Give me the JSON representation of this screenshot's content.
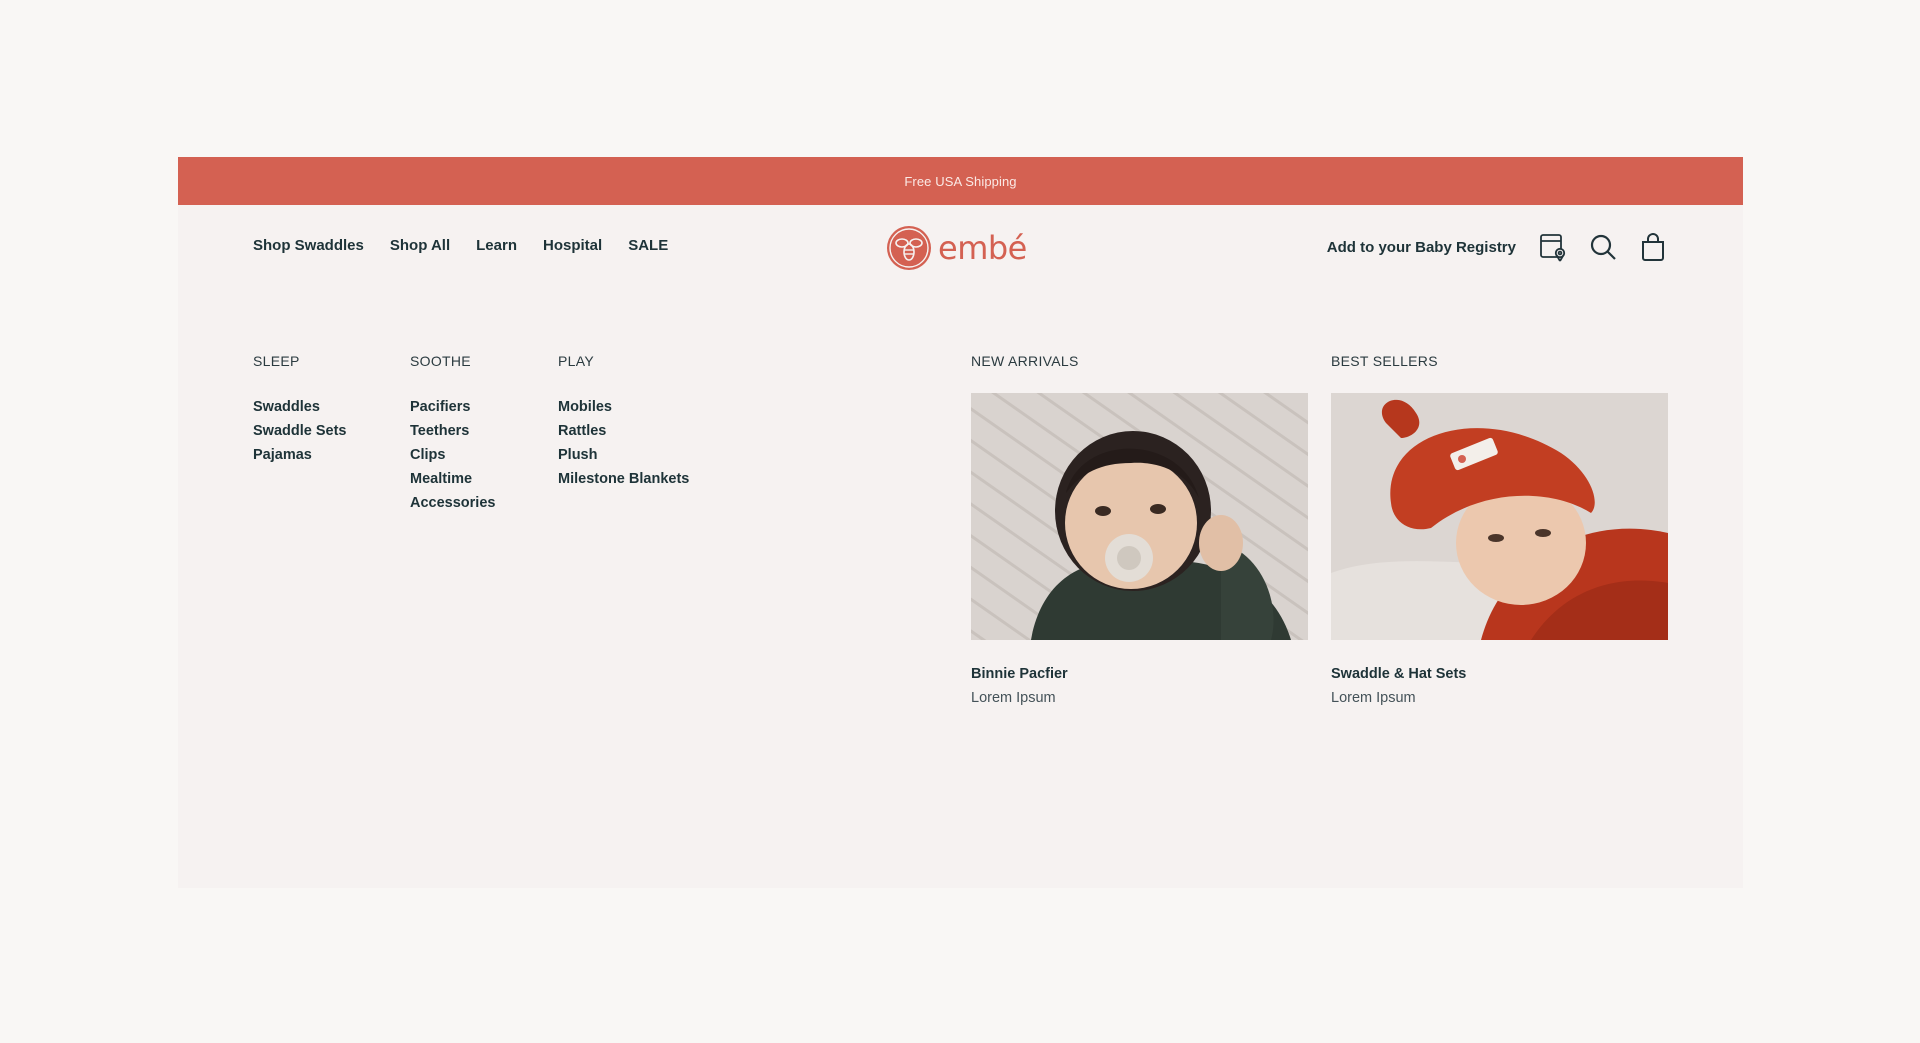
{
  "announcement": "Free USA Shipping",
  "brand": {
    "name": "embé",
    "accent": "#d46152"
  },
  "nav": {
    "left": [
      "Shop Swaddles",
      "Shop All",
      "Learn",
      "Hospital",
      "SALE"
    ],
    "registry": "Add to your Baby Registry",
    "icons": [
      "registry-gift-icon",
      "search-icon",
      "shopping-bag-icon"
    ]
  },
  "menu": {
    "columns": [
      {
        "heading": "SLEEP",
        "items": [
          "Swaddles",
          "Swaddle Sets",
          "Pajamas"
        ]
      },
      {
        "heading": "SOOTHE",
        "items": [
          "Pacifiers",
          "Teethers",
          "Clips",
          "Mealtime",
          "Accessories"
        ]
      },
      {
        "heading": "PLAY",
        "items": [
          "Mobiles",
          "Rattles",
          "Plush",
          "Milestone Blankets"
        ]
      }
    ],
    "features": [
      {
        "heading": "NEW ARRIVALS",
        "title": "Binnie Pacfier",
        "subtitle": "Lorem Ipsum"
      },
      {
        "heading": "BEST SELLERS",
        "title": "Swaddle & Hat Sets",
        "subtitle": "Lorem Ipsum"
      }
    ]
  }
}
